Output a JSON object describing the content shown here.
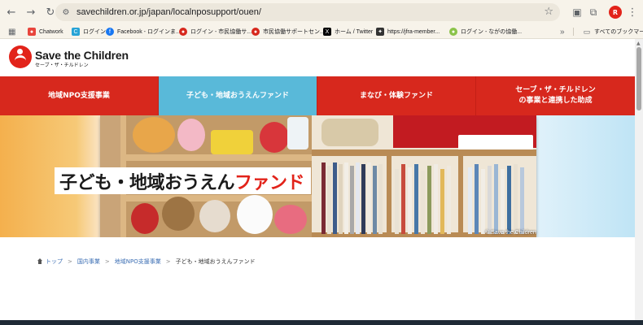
{
  "browser": {
    "url": "savechildren.or.jp/japan/localnposupport/ouen/",
    "bookmarks": [
      {
        "label": "Chatwork",
        "color": "#e8453c"
      },
      {
        "label": "ログイン",
        "color": "#27a3d6"
      },
      {
        "label": "Facebook - ログインま...",
        "color": "#1877f2"
      },
      {
        "label": "ログイン - 市民協働サ...",
        "color": "#d7281d"
      },
      {
        "label": "市民協働サポートセン...",
        "color": "#d7281d"
      },
      {
        "label": "ホーム / Twitter",
        "color": "#000000"
      },
      {
        "label": "https://jfra-member...",
        "color": "#333333"
      },
      {
        "label": "ログイン - ながの協働...",
        "color": "#8bc34a"
      }
    ],
    "all_bookmarks_label": "すべてのブックマーク",
    "avatar_label": "R"
  },
  "site": {
    "logo_name": "Save the Children",
    "logo_sub": "セーブ・ザ・チルドレン",
    "brand_color": "#d7281d"
  },
  "nav": {
    "items": [
      {
        "label": "地域NPO支援事業",
        "active": false
      },
      {
        "label": "子ども・地域おうえんファンド",
        "active": true
      },
      {
        "label": "まなび・体験ファンド",
        "active": false
      },
      {
        "label": "セーブ・ザ・チルドレン\nの事業と連携した助成",
        "active": false
      }
    ]
  },
  "hero": {
    "title_prefix": "子ども・地域おうえん",
    "title_accent": "ファンド",
    "credit": "© Save the Children"
  },
  "breadcrumb": {
    "items": [
      "トップ",
      "国内事業",
      "地域NPO支援事業"
    ],
    "current": "子ども・地域おうえんファンド",
    "separator": ">"
  }
}
